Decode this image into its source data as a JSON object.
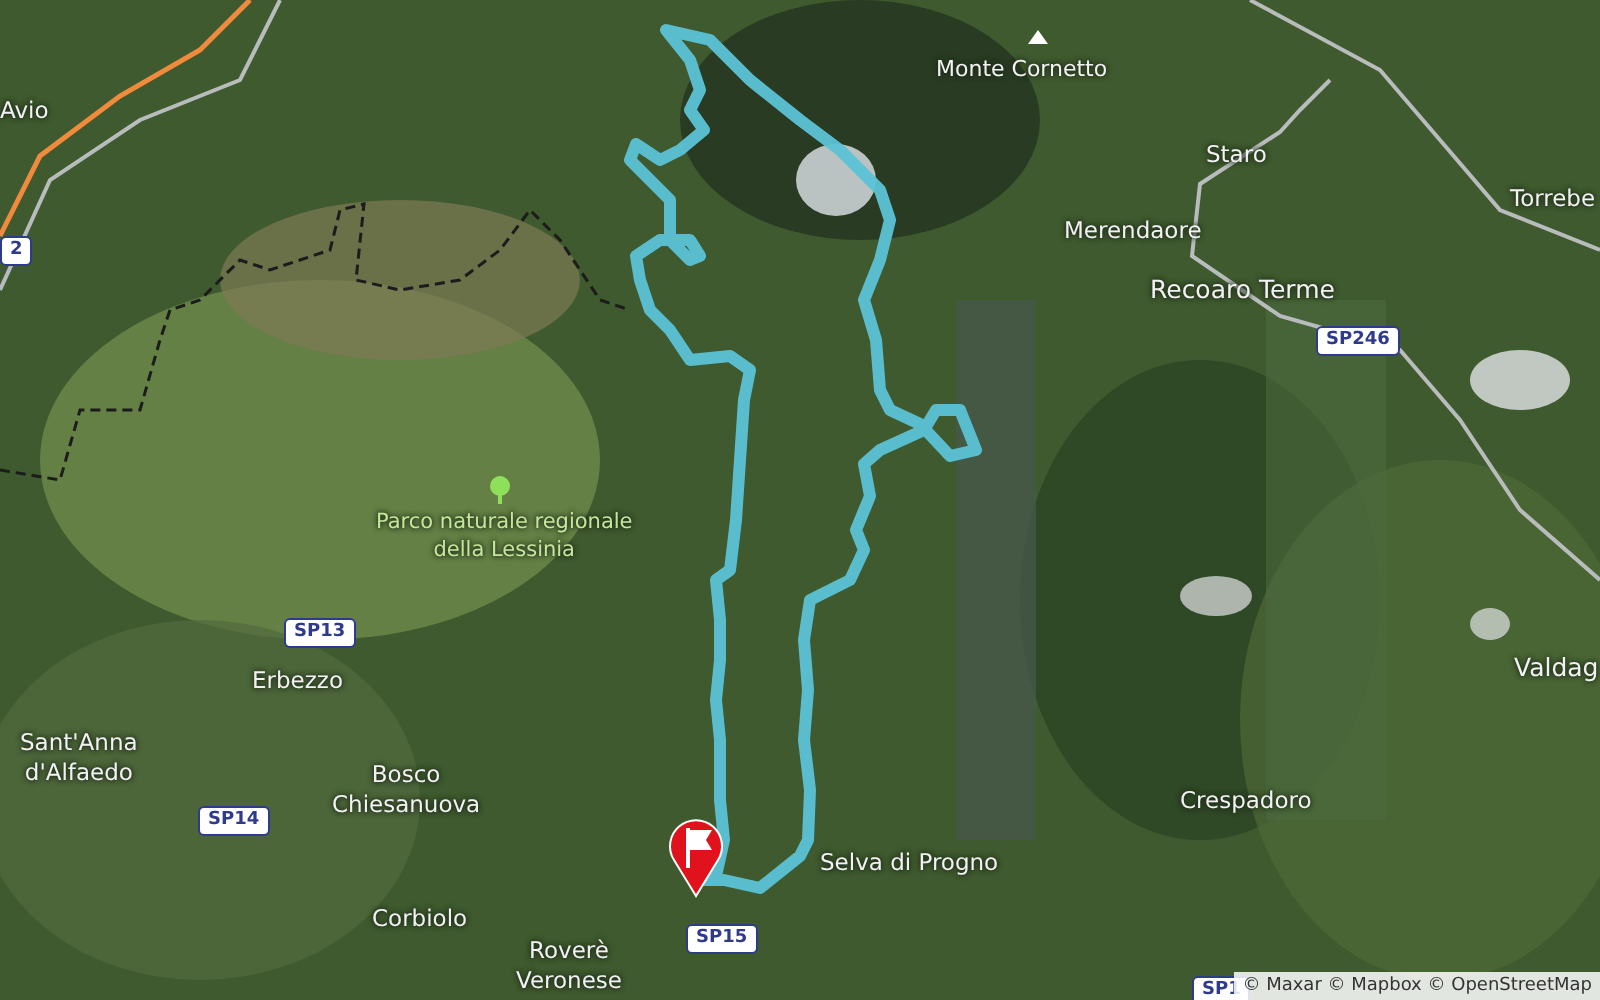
{
  "map": {
    "labels": [
      {
        "kind": "place",
        "text": "Avio"
      },
      {
        "kind": "road",
        "text": "2"
      },
      {
        "kind": "peak",
        "text": "Monte Cornetto"
      },
      {
        "kind": "place",
        "text": "Staro"
      },
      {
        "kind": "place",
        "text": "Torrebe"
      },
      {
        "kind": "place",
        "text": "Merendaore"
      },
      {
        "kind": "town",
        "text": "Recoaro Terme"
      },
      {
        "kind": "road",
        "text": "SP246"
      },
      {
        "kind": "park",
        "text": "Parco naturale regionale\ndella Lessinia"
      },
      {
        "kind": "road",
        "text": "SP13"
      },
      {
        "kind": "place",
        "text": "Erbezzo"
      },
      {
        "kind": "place",
        "text": "Sant'Anna\nd'Alfaedo"
      },
      {
        "kind": "place",
        "text": "Bosco\nChiesanuova"
      },
      {
        "kind": "road",
        "text": "SP14"
      },
      {
        "kind": "place",
        "text": "Corbiolo"
      },
      {
        "kind": "place",
        "text": "Roverè\nVeronese"
      },
      {
        "kind": "road",
        "text": "SP15"
      },
      {
        "kind": "place",
        "text": "Selva di Progno"
      },
      {
        "kind": "place",
        "text": "Crespadoro"
      },
      {
        "kind": "town",
        "text": "Valdag"
      },
      {
        "kind": "road",
        "text": "SP1"
      }
    ]
  },
  "attribution": "© Maxar © Mapbox © OpenStreetMap"
}
